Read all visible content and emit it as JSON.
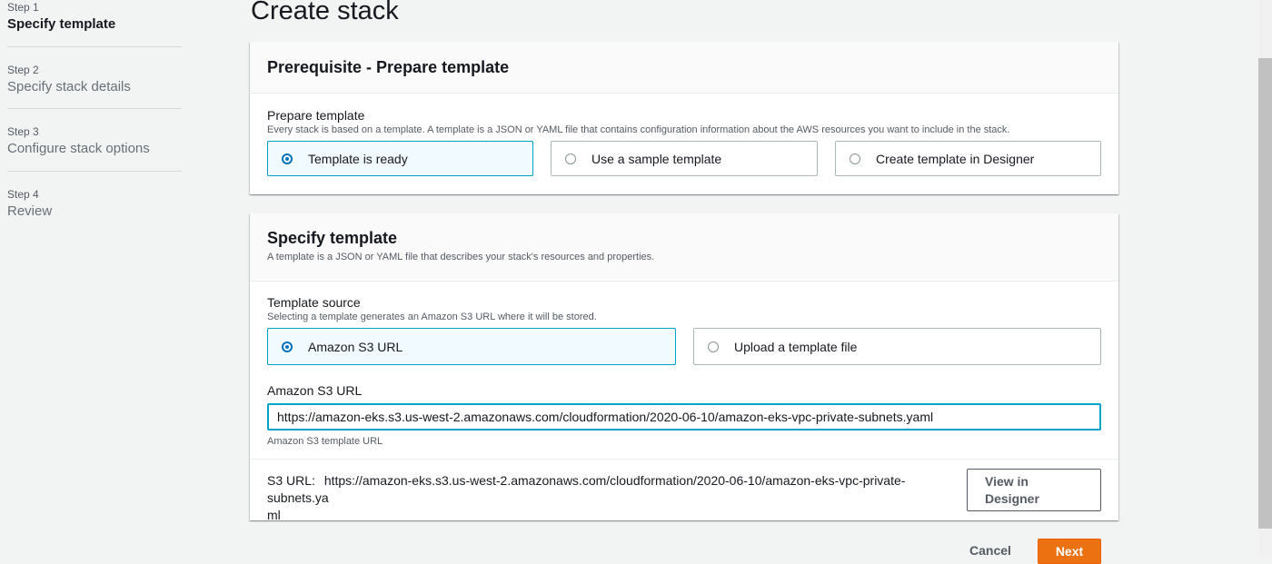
{
  "steps": [
    {
      "num": "Step 1",
      "title": "Specify template"
    },
    {
      "num": "Step 2",
      "title": "Specify stack details"
    },
    {
      "num": "Step 3",
      "title": "Configure stack options"
    },
    {
      "num": "Step 4",
      "title": "Review"
    }
  ],
  "page": {
    "title": "Create stack"
  },
  "prerequisite": {
    "header": "Prerequisite - Prepare template",
    "label": "Prepare template",
    "description": "Every stack is based on a template. A template is a JSON or YAML file that contains configuration information about the AWS resources you want to include in the stack.",
    "options": [
      "Template is ready",
      "Use a sample template",
      "Create template in Designer"
    ],
    "selected": "Template is ready"
  },
  "specify": {
    "header": "Specify template",
    "description": "A template is a JSON or YAML file that describes your stack's resources and properties.",
    "source_label": "Template source",
    "source_description": "Selecting a template generates an Amazon S3 URL where it will be stored.",
    "options": [
      "Amazon S3 URL",
      "Upload a template file"
    ],
    "selected": "Amazon S3 URL",
    "url_label": "Amazon S3 URL",
    "url_value": "https://amazon-eks.s3.us-west-2.amazonaws.com/cloudformation/2020-06-10/amazon-eks-vpc-private-subnets.yaml",
    "url_hint": "Amazon S3 template URL",
    "s3_url_label": "S3 URL:",
    "s3_url_value_line1": "https://amazon-eks.s3.us-west-2.amazonaws.com/cloudformation/2020-06-10/amazon-eks-vpc-private-subnets.ya",
    "s3_url_value_line2": "ml",
    "view_designer_line1": "View in",
    "view_designer_line2": "Designer"
  },
  "footer": {
    "cancel": "Cancel",
    "next": "Next"
  },
  "colors": {
    "accent": "#00a1c9",
    "primary_button": "#ec7211",
    "selected_tile": "#f1faff"
  }
}
